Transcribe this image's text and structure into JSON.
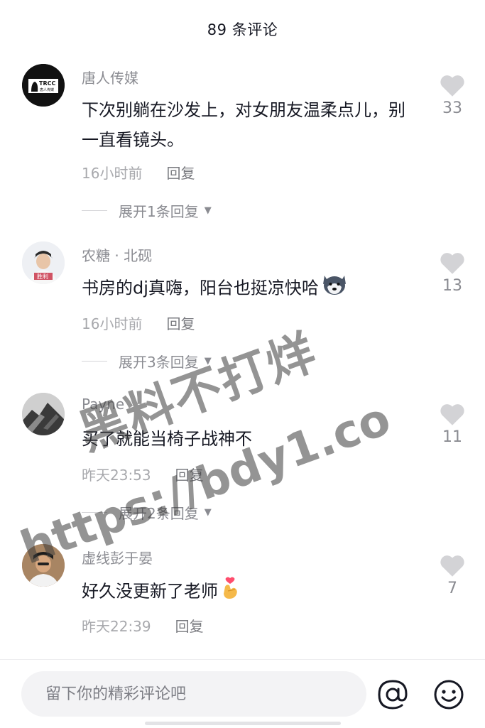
{
  "header": {
    "title": "89 条评论"
  },
  "comments": [
    {
      "username": "唐人传媒",
      "avatar_text": "TRCC",
      "avatar_sub": "唐人传媒",
      "text": "下次别躺在沙发上，对女朋友温柔点儿，别一直看镜头。",
      "time": "16小时前",
      "reply_label": "回复",
      "expand_label": "展开1条回复",
      "likes": "33"
    },
    {
      "username": "农糖 · 北砚",
      "avatar_label": "胜利",
      "text": "书房的dj真嗨，阳台也挺凉快哈",
      "emoji": "husky-dog-emoji",
      "time": "16小时前",
      "reply_label": "回复",
      "expand_label": "展开3条回复",
      "likes": "13"
    },
    {
      "username": "Payne",
      "text": "买了就能当椅子战神不",
      "time": "昨天23:53",
      "reply_label": "回复",
      "expand_label": "展开2条回复",
      "likes": "11"
    },
    {
      "username": "虚线彭于晏",
      "text": "好久没更新了老师",
      "emoji": "finger-heart-emoji",
      "time": "昨天22:39",
      "reply_label": "回复",
      "likes": "7"
    }
  ],
  "input": {
    "placeholder": "留下你的精彩评论吧"
  },
  "icons": {
    "at": "at-icon",
    "emoji": "smile-icon",
    "like": "heart-icon"
  },
  "watermark": {
    "line1": "黑料不打烊",
    "line2": "https://bdy1.co"
  },
  "colors": {
    "like": "#d3d3d6",
    "secondary_text": "#8a8b91",
    "primary_text": "#161823"
  }
}
